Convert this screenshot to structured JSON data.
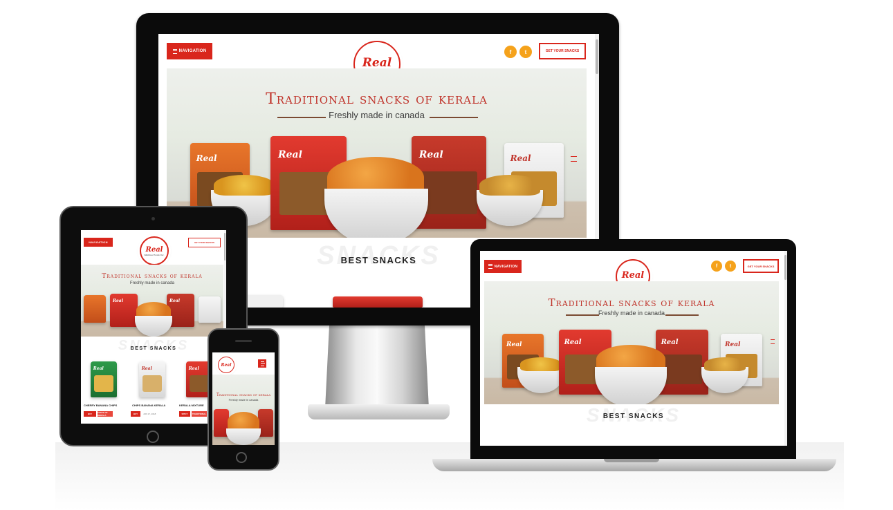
{
  "brand": {
    "logo_main": "Real",
    "logo_sub": "Mennus Foods Inc."
  },
  "header": {
    "nav_label": "NAVIGATION",
    "cta_label": "GET YOUR SNACKS",
    "social": [
      {
        "glyph": "f",
        "icon": "facebook-icon"
      },
      {
        "glyph": "t",
        "icon": "twitter-icon"
      }
    ]
  },
  "hero": {
    "title": "Traditional snacks of kerala",
    "subtitle": "Freshly made in canada"
  },
  "section": {
    "title": "BEST SNACKS",
    "ghost": "SNACKS"
  },
  "products": [
    {
      "name": "CHERRY BANANA CHIPS",
      "btn": "BUY",
      "meta": "TASTE OF KERALA"
    },
    {
      "name": "CHIPS BANANA KERALA",
      "btn": "BUY",
      "meta": "JUN 17, 2018"
    },
    {
      "name": "KERALA MIXTURE",
      "btn": "SPICY",
      "meta": "TRADITIONAL"
    }
  ],
  "colors": {
    "brand_red": "#d9261c",
    "social_orange": "#f5a21b"
  }
}
